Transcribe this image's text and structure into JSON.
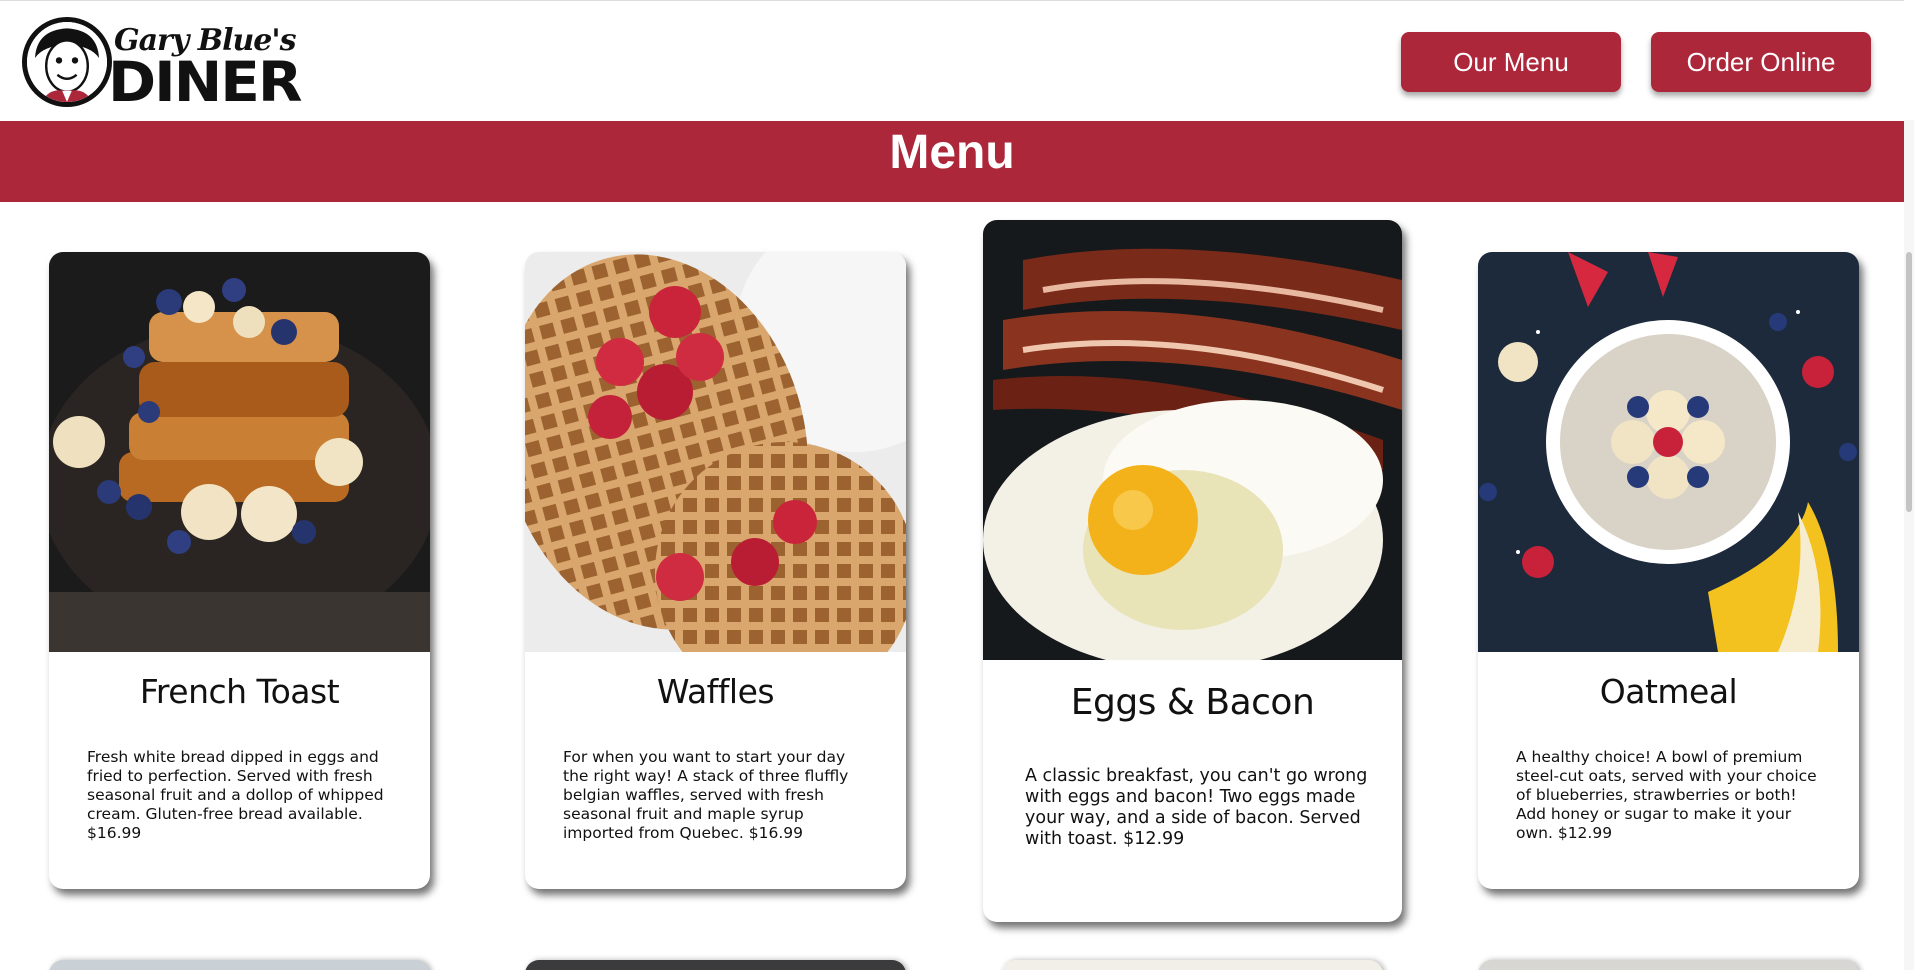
{
  "brand": {
    "line1": "Gary Blue's",
    "line2": "DINER"
  },
  "nav": {
    "menu_label": "Our Menu",
    "order_label": "Order Online"
  },
  "banner": {
    "title": "Menu"
  },
  "colors": {
    "accent": "#ad273b"
  },
  "menu_items": [
    {
      "name": "French Toast",
      "description": "Fresh white bread dipped in eggs and fried to perfection. Served with fresh seasonal fruit and a dollop of whipped cream. Gluten-free bread available. $16.99"
    },
    {
      "name": "Waffles",
      "description": "For when you want to start your day the right way! A stack of three fluffly belgian waffles, served with fresh seasonal fruit and maple syrup imported from Quebec. $16.99"
    },
    {
      "name": "Eggs & Bacon",
      "description": "A classic breakfast, you can't go wrong with eggs and bacon! Two eggs made your way, and a side of bacon. Served with toast. $12.99"
    },
    {
      "name": "Oatmeal",
      "description": "A healthy choice! A bowl of premium steel-cut oats, served with your choice of blueberries, strawberries or both! Add honey or sugar to make it your own. $12.99"
    }
  ]
}
